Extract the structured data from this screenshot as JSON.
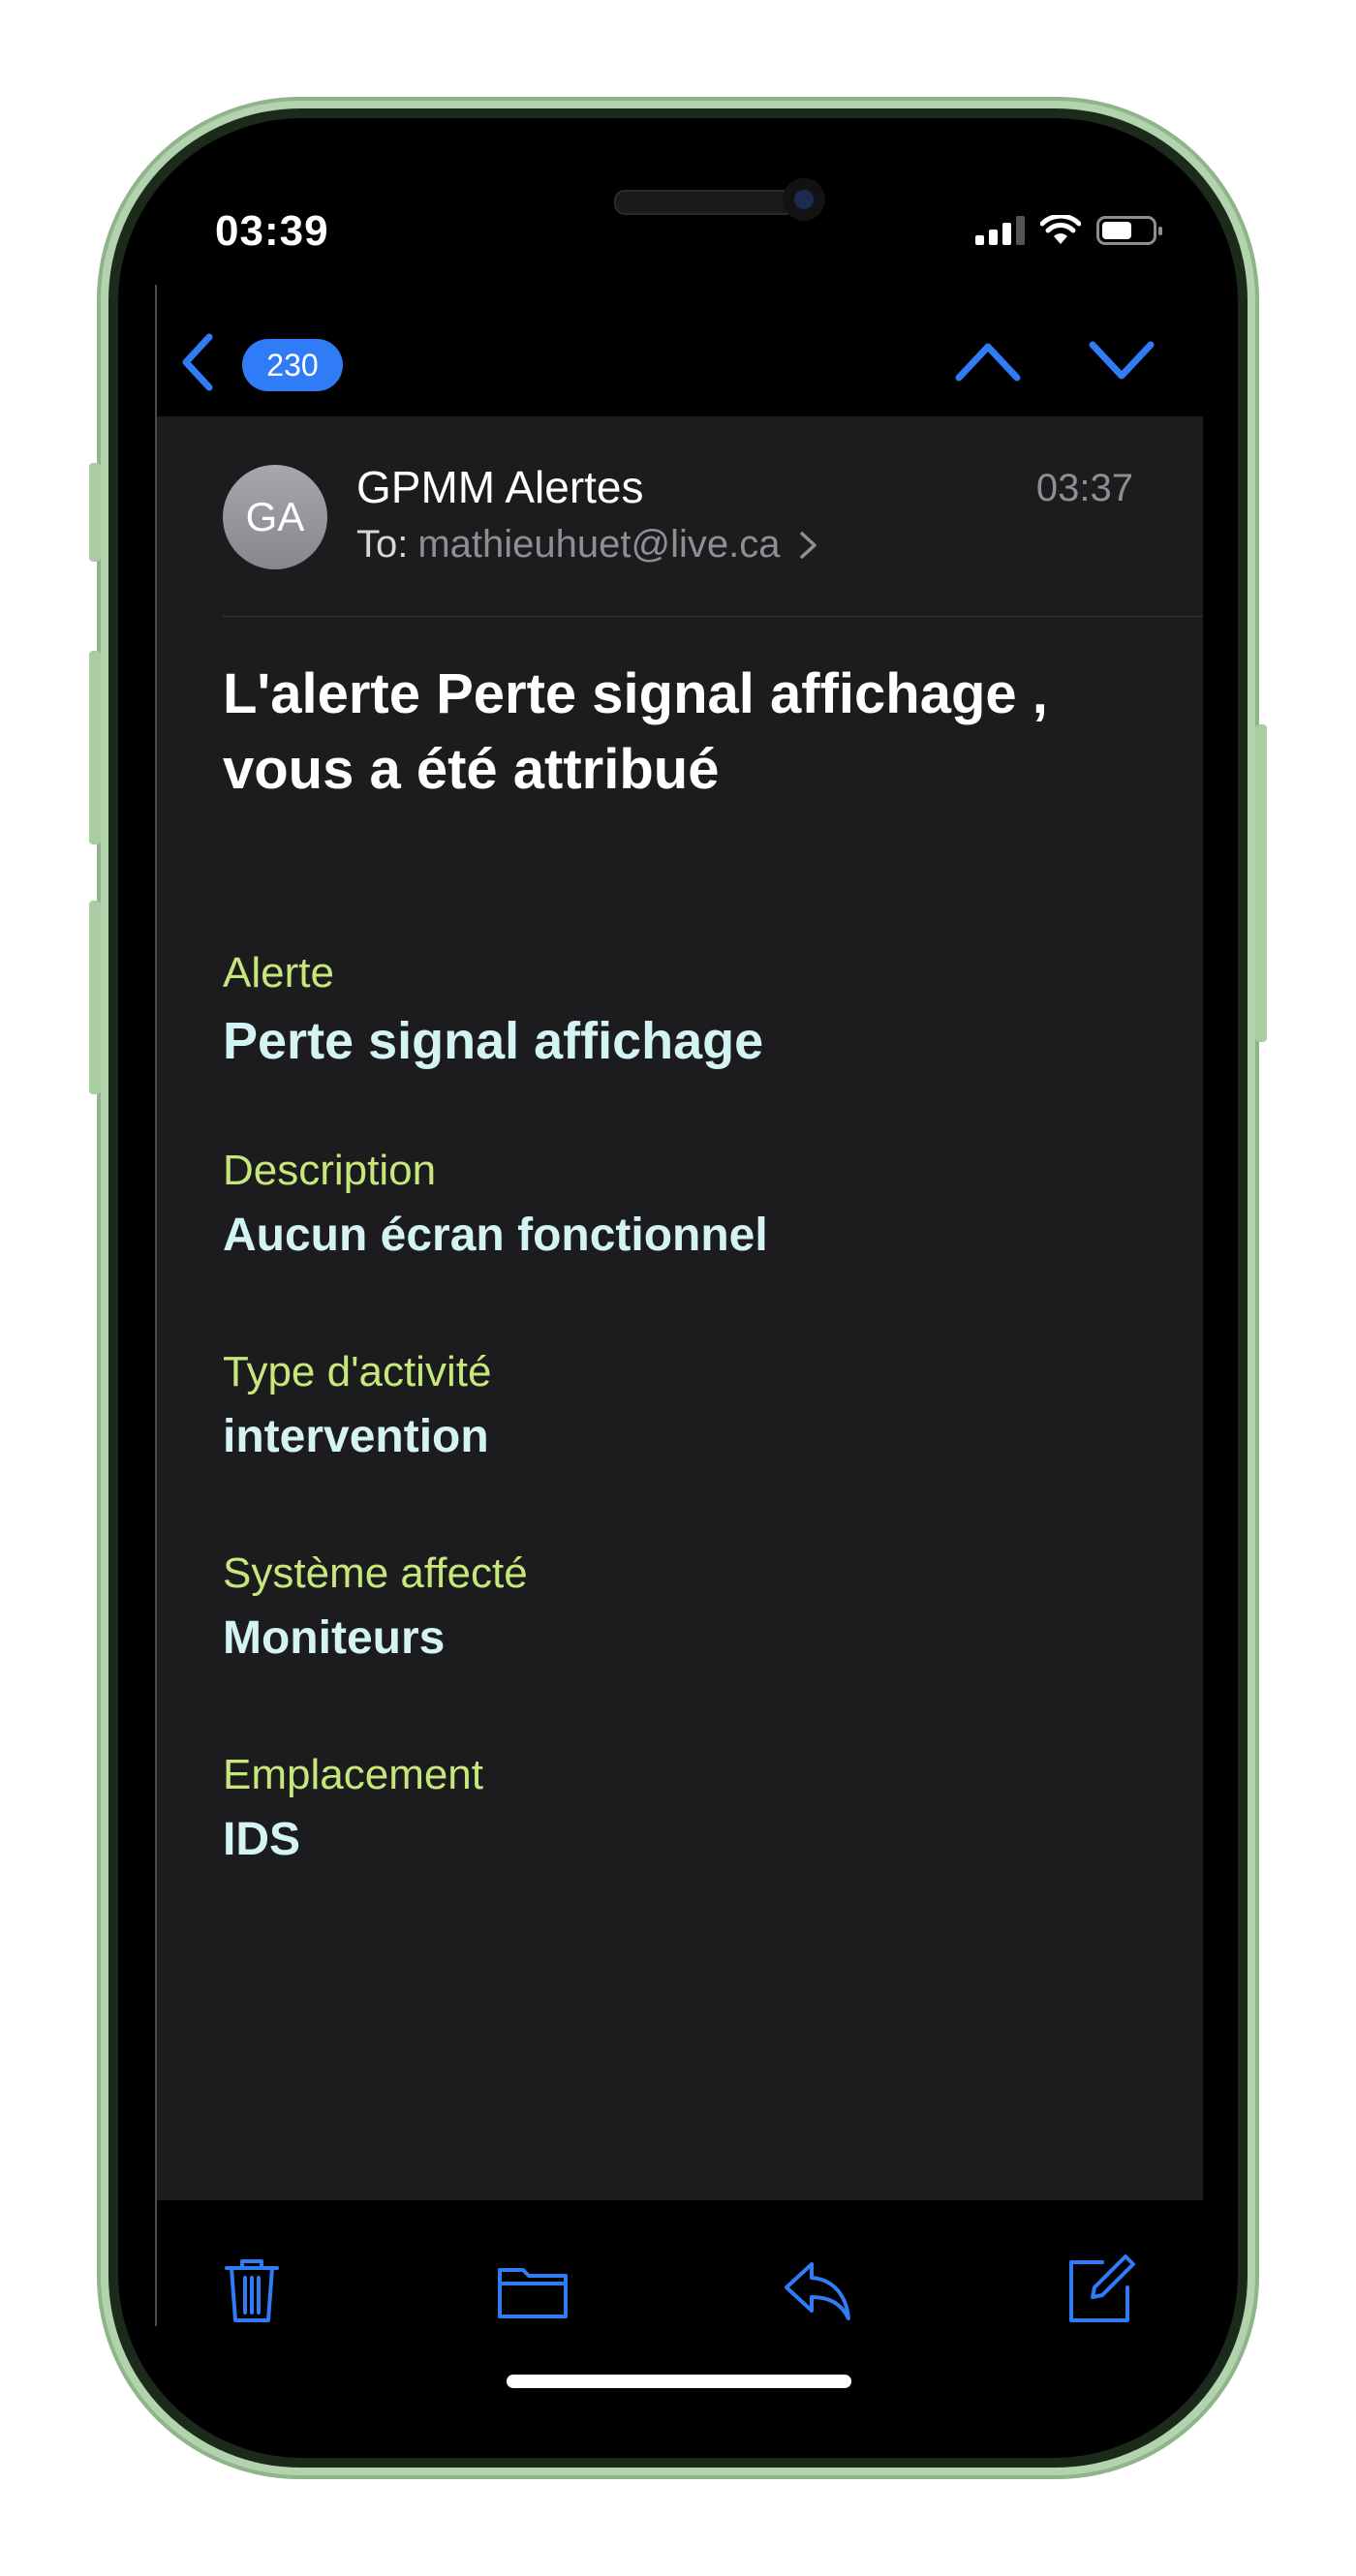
{
  "status_bar": {
    "time": "03:39",
    "battery_level": 0.6
  },
  "navbar": {
    "unread_count": "230"
  },
  "email": {
    "avatar_initials": "GA",
    "sender": "GPMM Alertes",
    "received_time": "03:37",
    "to_prefix": "To:",
    "to_address": "mathieuhuet@live.ca",
    "subject": "L'alerte Perte signal affichage , vous a été attribué",
    "fields": [
      {
        "label": "Alerte",
        "value": "Perte signal affichage"
      },
      {
        "label": "Description",
        "value": "Aucun écran fonctionnel"
      },
      {
        "label": "Type d'activité",
        "value": "intervention"
      },
      {
        "label": "Système affecté",
        "value": "Moniteurs"
      },
      {
        "label": "Emplacement",
        "value": "IDS"
      }
    ]
  },
  "toolbar": {
    "icons": [
      "trash-icon",
      "folder-icon",
      "reply-icon",
      "compose-icon"
    ]
  },
  "colors": {
    "accent": "#2f7cf6",
    "label": "#c6e87a",
    "value": "#d4f3f3",
    "background": "#1c1c1e",
    "phone_frame": "#b3d3ae"
  }
}
